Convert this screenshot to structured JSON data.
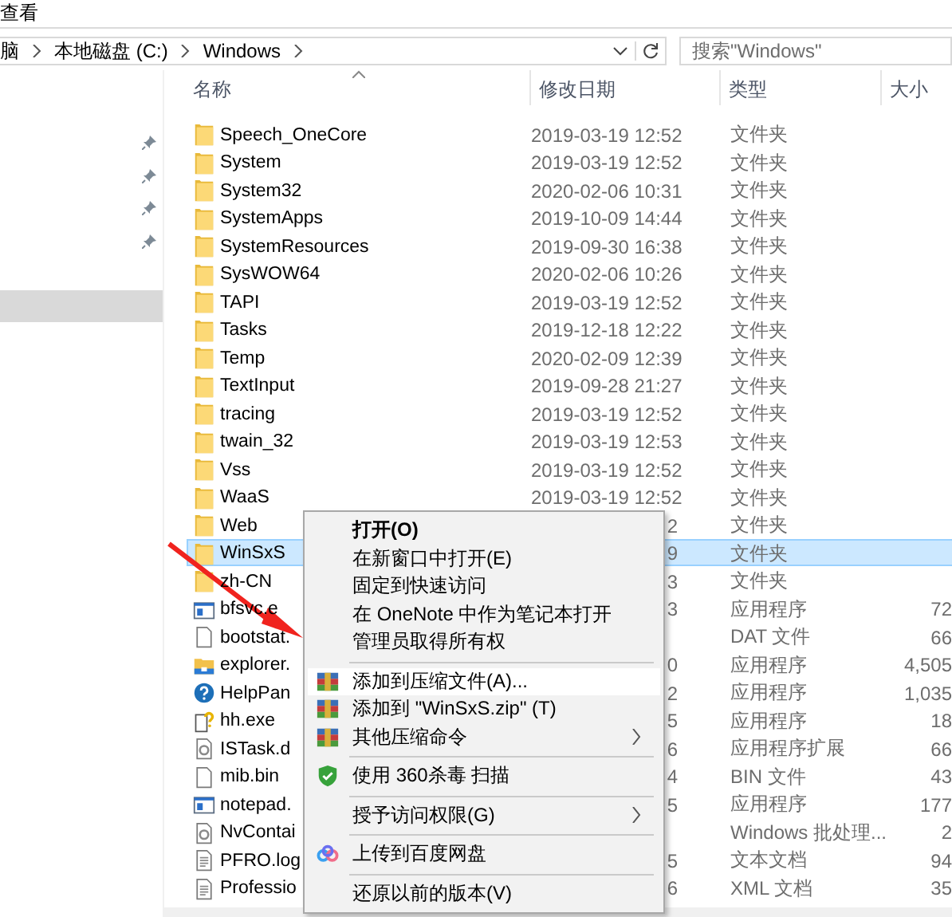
{
  "ribbon": {
    "tab": "查看"
  },
  "address": {
    "crumbs": [
      "脑",
      "本地磁盘 (C:)",
      "Windows"
    ]
  },
  "search": {
    "placeholder": "搜索\"Windows\""
  },
  "nav": {
    "items": [
      {
        "pinned": true,
        "selected": false
      },
      {
        "pinned": true,
        "selected": false
      },
      {
        "pinned": true,
        "selected": false
      },
      {
        "pinned": true,
        "selected": false
      },
      {
        "pinned": false,
        "selected": false
      },
      {
        "pinned": false,
        "selected": true
      }
    ]
  },
  "columns": [
    "名称",
    "修改日期",
    "类型",
    "大小"
  ],
  "files": [
    {
      "kind": "folder",
      "name": "Speech_OneCore",
      "date": "2019-03-19 12:52",
      "type": "文件夹",
      "selected": false
    },
    {
      "kind": "folder",
      "name": "System",
      "date": "2019-03-19 12:52",
      "type": "文件夹",
      "selected": false
    },
    {
      "kind": "folder",
      "name": "System32",
      "date": "2020-02-06 10:31",
      "type": "文件夹",
      "selected": false
    },
    {
      "kind": "folder",
      "name": "SystemApps",
      "date": "2019-10-09 14:44",
      "type": "文件夹",
      "selected": false
    },
    {
      "kind": "folder",
      "name": "SystemResources",
      "date": "2019-09-30 16:38",
      "type": "文件夹",
      "selected": false
    },
    {
      "kind": "folder",
      "name": "SysWOW64",
      "date": "2020-02-06 10:26",
      "type": "文件夹",
      "selected": false
    },
    {
      "kind": "folder",
      "name": "TAPI",
      "date": "2019-03-19 12:52",
      "type": "文件夹",
      "selected": false
    },
    {
      "kind": "folder",
      "name": "Tasks",
      "date": "2019-12-18 12:22",
      "type": "文件夹",
      "selected": false
    },
    {
      "kind": "folder",
      "name": "Temp",
      "date": "2020-02-09 12:39",
      "type": "文件夹",
      "selected": false
    },
    {
      "kind": "folder",
      "name": "TextInput",
      "date": "2019-09-28 21:27",
      "type": "文件夹",
      "selected": false
    },
    {
      "kind": "folder",
      "name": "tracing",
      "date": "2019-03-19 12:52",
      "type": "文件夹",
      "selected": false
    },
    {
      "kind": "folder",
      "name": "twain_32",
      "date": "2019-03-19 12:53",
      "type": "文件夹",
      "selected": false
    },
    {
      "kind": "folder",
      "name": "Vss",
      "date": "2019-03-19 12:52",
      "type": "文件夹",
      "selected": false
    },
    {
      "kind": "folder",
      "name": "WaaS",
      "date": "2019-03-19 12:52",
      "type": "文件夹",
      "selected": false
    },
    {
      "kind": "folder",
      "name": "Web",
      "date": "2",
      "type": "文件夹",
      "selected": false
    },
    {
      "kind": "folder",
      "name": "WinSxS",
      "date": "9",
      "type": "文件夹",
      "selected": true
    },
    {
      "kind": "folder",
      "name": "zh-CN",
      "date": "3",
      "type": "文件夹",
      "selected": false
    },
    {
      "kind": "app",
      "name": "bfsvc.e",
      "date": "3",
      "type": "应用程序",
      "size": "72",
      "selected": false
    },
    {
      "kind": "file",
      "name": "bootstat.",
      "type": "DAT 文件",
      "size": "66",
      "selected": false
    },
    {
      "kind": "explorer",
      "name": "explorer.",
      "date": "0",
      "type": "应用程序",
      "size": "4,505",
      "selected": false
    },
    {
      "kind": "help",
      "name": "HelpPan",
      "date": "2",
      "type": "应用程序",
      "size": "1,035",
      "selected": false
    },
    {
      "kind": "helpdoc",
      "name": "hh.exe",
      "date": "5",
      "type": "应用程序",
      "size": "18",
      "selected": false
    },
    {
      "kind": "library",
      "name": "ISTask.d",
      "date": "6",
      "type": "应用程序扩展",
      "size": "66",
      "selected": false
    },
    {
      "kind": "file",
      "name": "mib.bin",
      "date": "4",
      "type": "BIN 文件",
      "size": "43",
      "selected": false
    },
    {
      "kind": "app",
      "name": "notepad.",
      "date": "5",
      "type": "应用程序",
      "size": "177",
      "selected": false
    },
    {
      "kind": "library",
      "name": "NvContai",
      "type": "Windows 批处理...",
      "size": "2",
      "selected": false
    },
    {
      "kind": "text",
      "name": "PFRO.log",
      "date": "5",
      "type": "文本文档",
      "size": "94",
      "selected": false
    },
    {
      "kind": "text",
      "name": "Professio",
      "date": "6",
      "type": "XML 文档",
      "size": "35",
      "selected": false
    }
  ],
  "menu": {
    "groups": [
      [
        {
          "kind": "plain",
          "label": "打开(O)",
          "default": true,
          "selected": false,
          "submenu": false
        },
        {
          "kind": "plain",
          "label": "在新窗口中打开(E)",
          "default": false,
          "selected": false,
          "submenu": false
        },
        {
          "kind": "plain",
          "label": "固定到快速访问",
          "default": false,
          "selected": false,
          "submenu": false
        },
        {
          "kind": "plain",
          "label": "在 OneNote 中作为笔记本打开",
          "default": false,
          "selected": false,
          "submenu": false
        },
        {
          "kind": "plain",
          "label": "管理员取得所有权",
          "default": false,
          "selected": false,
          "submenu": false
        }
      ],
      [
        {
          "kind": "archive",
          "label": "添加到压缩文件(A)...",
          "default": false,
          "selected": true,
          "submenu": false
        },
        {
          "kind": "archive",
          "label": "添加到 \"WinSxS.zip\" (T)",
          "default": false,
          "selected": false,
          "submenu": false
        },
        {
          "kind": "archive",
          "label": "其他压缩命令",
          "default": false,
          "selected": false,
          "submenu": true
        }
      ],
      [
        {
          "kind": "shield",
          "label": "使用 360杀毒 扫描",
          "default": false,
          "selected": false,
          "submenu": false
        }
      ],
      [
        {
          "kind": "plain",
          "label": "授予访问权限(G)",
          "default": false,
          "selected": false,
          "submenu": true
        }
      ],
      [
        {
          "kind": "cloud",
          "label": "上传到百度网盘",
          "default": false,
          "selected": false,
          "submenu": false
        }
      ],
      [
        {
          "kind": "plain",
          "label": "还原以前的版本(V)",
          "default": false,
          "selected": false,
          "submenu": false
        }
      ]
    ]
  }
}
